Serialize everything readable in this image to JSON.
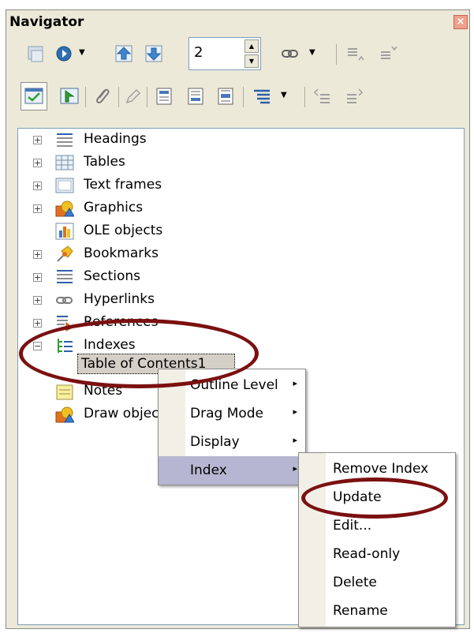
{
  "window": {
    "title": "Navigator",
    "close_glyph": "×"
  },
  "toolbar": {
    "level_value": "2",
    "spin_up": "▲",
    "spin_down": "▼",
    "dropdown_glyph": "▼"
  },
  "tree": {
    "items": [
      {
        "label": "Headings",
        "icon": "headings-icon",
        "expandable": true
      },
      {
        "label": "Tables",
        "icon": "tables-icon",
        "expandable": true
      },
      {
        "label": "Text frames",
        "icon": "text-frames-icon",
        "expandable": true
      },
      {
        "label": "Graphics",
        "icon": "graphics-icon",
        "expandable": true
      },
      {
        "label": "OLE objects",
        "icon": "ole-objects-icon",
        "expandable": false
      },
      {
        "label": "Bookmarks",
        "icon": "bookmarks-icon",
        "expandable": true
      },
      {
        "label": "Sections",
        "icon": "sections-icon",
        "expandable": true
      },
      {
        "label": "Hyperlinks",
        "icon": "hyperlinks-icon",
        "expandable": true
      },
      {
        "label": "References",
        "icon": "references-icon",
        "expandable": true
      },
      {
        "label": "Indexes",
        "icon": "indexes-icon",
        "expandable": true,
        "expanded": true
      },
      {
        "label": "Notes",
        "icon": "notes-icon",
        "expandable": false
      },
      {
        "label": "Draw objects",
        "icon": "draw-objects-icon",
        "expandable": false
      }
    ],
    "expand_glyph": "+",
    "collapse_glyph": "−",
    "selected_child": "Table of Contents1"
  },
  "context_menu": {
    "items": [
      {
        "label": "Outline Level",
        "arrow": "▸"
      },
      {
        "label": "Drag Mode",
        "arrow": "▸"
      },
      {
        "label": "Display",
        "arrow": "▸"
      },
      {
        "label": "Index",
        "arrow": "▸"
      }
    ]
  },
  "submenu": {
    "items": [
      {
        "label": "Remove Index"
      },
      {
        "label": "Update"
      },
      {
        "label": "Edit..."
      },
      {
        "label": "Read-only"
      },
      {
        "label": "Delete"
      },
      {
        "label": "Rename"
      }
    ]
  },
  "colors": {
    "panel_bg": "#ece9d8",
    "highlight": "#b6b6d2",
    "annotation_oval": "#7b1010",
    "tree_border": "#7f9db9"
  }
}
